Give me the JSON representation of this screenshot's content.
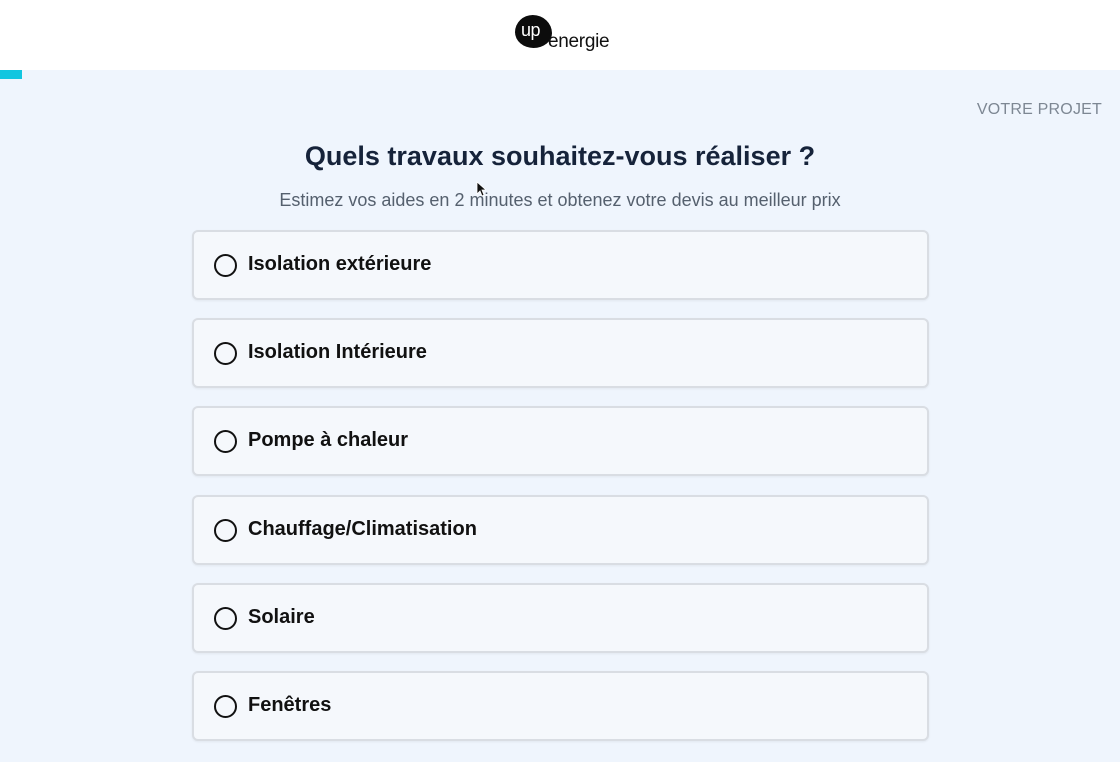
{
  "brand": {
    "logo_up": "up",
    "logo_energie": "energie",
    "colors": {
      "accent": "#12c6e0",
      "background": "#eff5fd",
      "title": "#16233a"
    }
  },
  "progress": {
    "fraction": 0.02
  },
  "step": {
    "label": "VOTRE PROJET"
  },
  "question": {
    "title": "Quels travaux souhaitez-vous réaliser ?",
    "subtitle": "Estimez vos aides en 2 minutes et obtenez votre devis au meilleur prix"
  },
  "options": [
    {
      "label": "Isolation extérieure",
      "selected": false
    },
    {
      "label": "Isolation Intérieure",
      "selected": false
    },
    {
      "label": "Pompe à chaleur",
      "selected": false
    },
    {
      "label": "Chauffage/Climatisation",
      "selected": false
    },
    {
      "label": "Solaire",
      "selected": false
    },
    {
      "label": "Fenêtres",
      "selected": false
    }
  ],
  "icons": {
    "cursor": "mouse-pointer-icon",
    "radio": "radio-unchecked-icon"
  }
}
